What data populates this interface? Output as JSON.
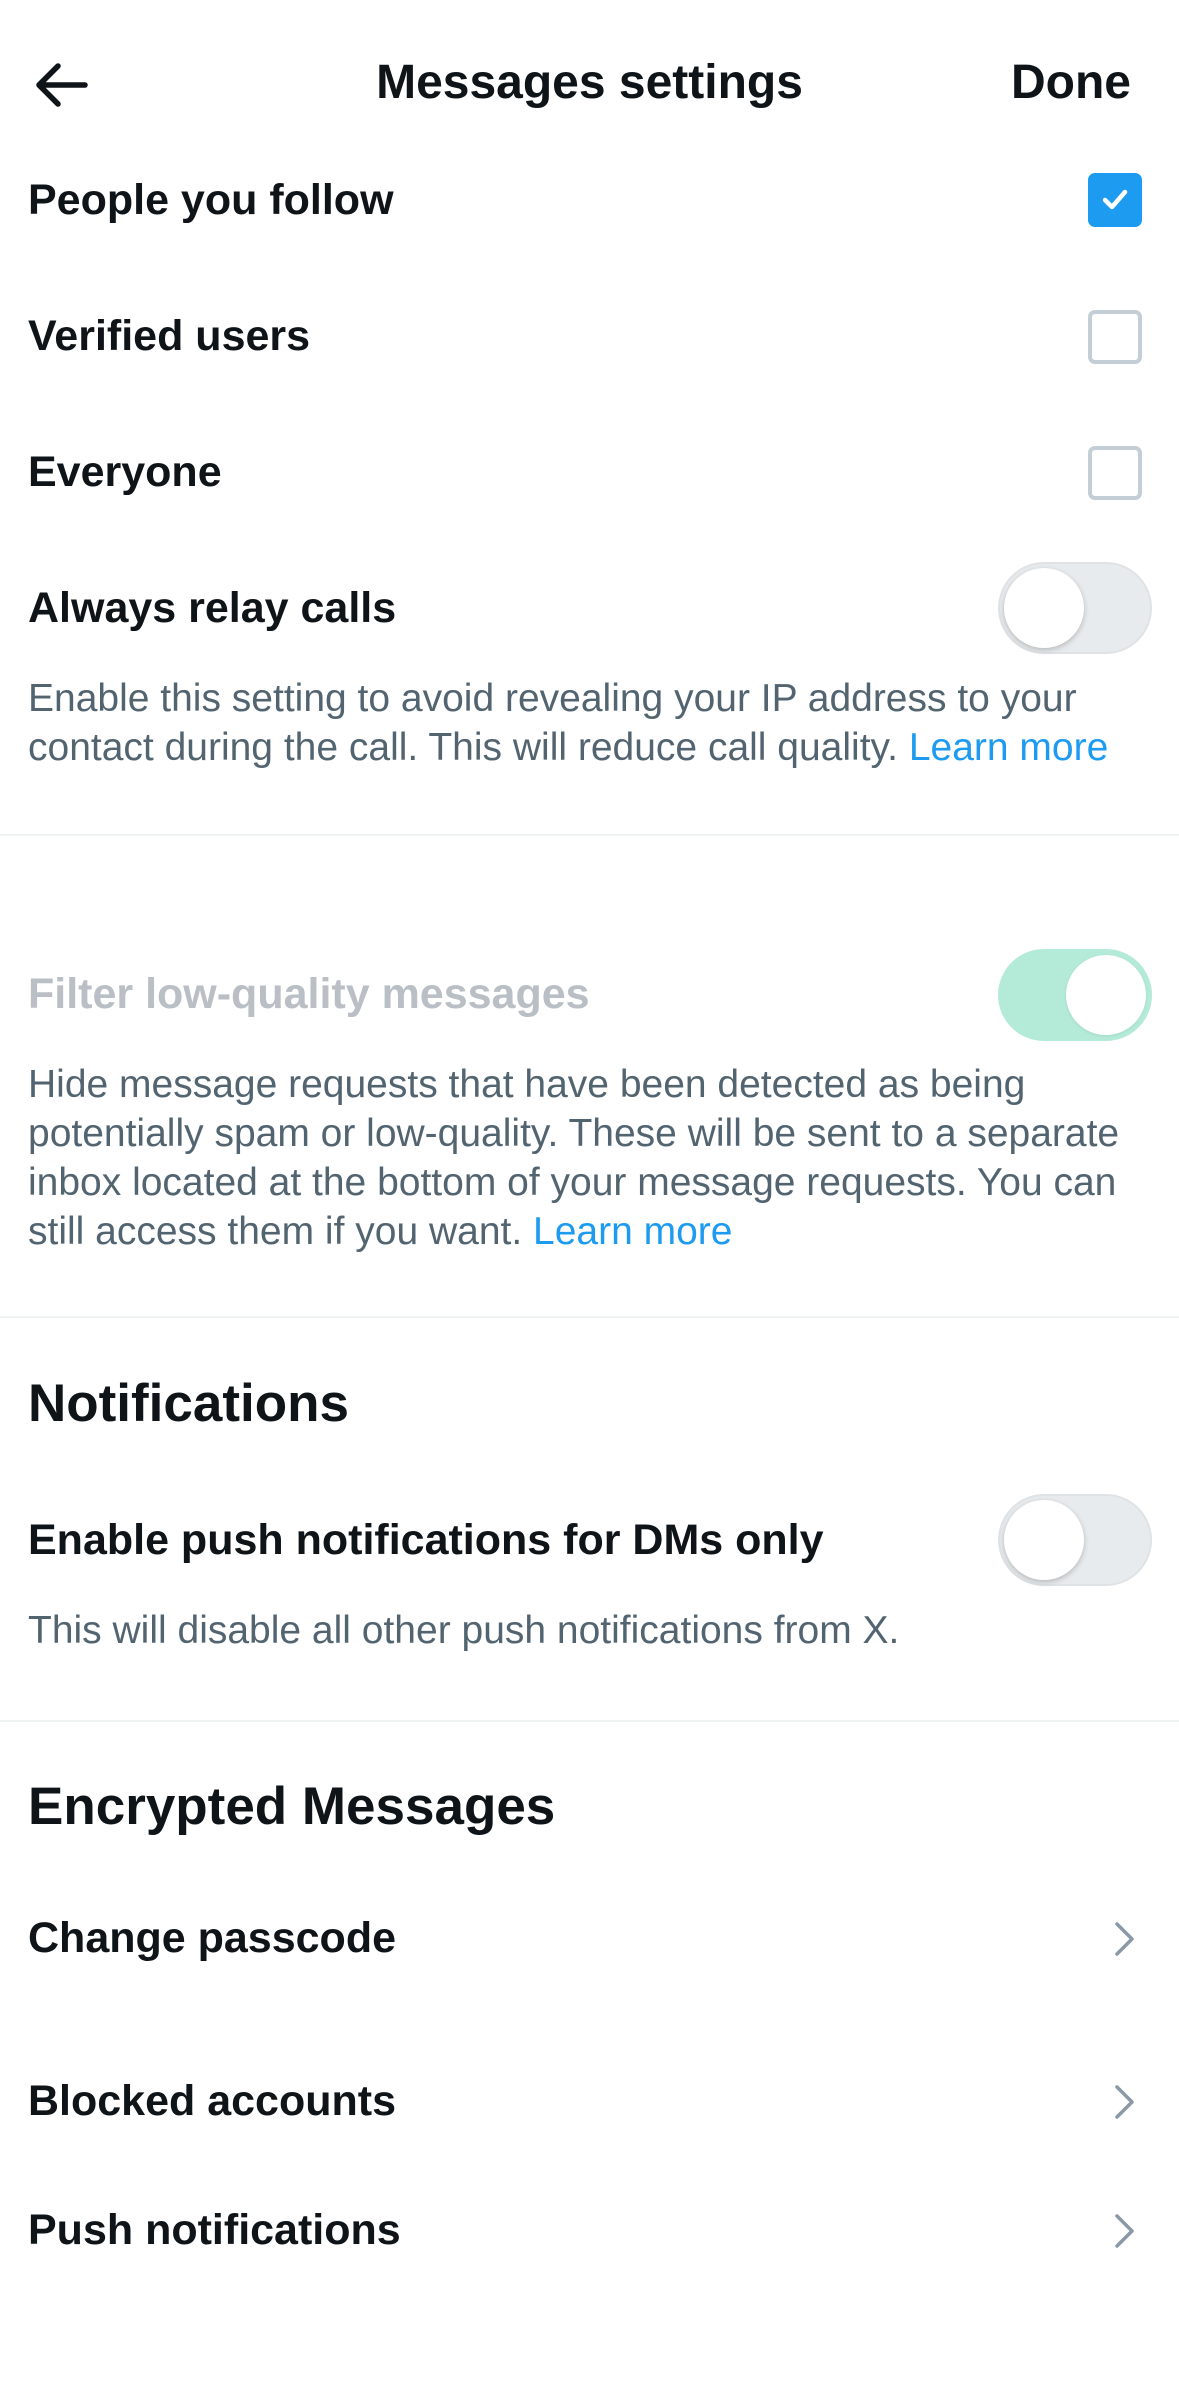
{
  "header": {
    "title": "Messages settings",
    "done_label": "Done"
  },
  "allow_requests": [
    {
      "label": "People you follow",
      "checked": true
    },
    {
      "label": "Verified users",
      "checked": false
    },
    {
      "label": "Everyone",
      "checked": false
    }
  ],
  "relay_calls": {
    "label": "Always relay calls",
    "enabled": false,
    "description": "Enable this setting to avoid revealing your IP address to your contact during the call. This will reduce call quality.",
    "link": "Learn more"
  },
  "filter": {
    "label": "Filter low-quality messages",
    "enabled": true,
    "disabled": true,
    "description": "Hide message requests that have been detected as being potentially spam or low-quality. These will be sent to a separate inbox located at the bottom of your message requests. You can still access them if you want.",
    "link": "Learn more"
  },
  "notifications": {
    "heading": "Notifications",
    "push_label": "Enable push notifications for DMs only",
    "enabled": false,
    "description": "This will disable all other push notifications from X."
  },
  "encrypted": {
    "heading": "Encrypted Messages",
    "items": [
      {
        "label": "Change passcode"
      },
      {
        "label": "Blocked accounts"
      },
      {
        "label": "Push notifications"
      }
    ]
  },
  "colors": {
    "accent": "#1d9bf0",
    "toggle_on": "#b4ead8",
    "text_primary": "#0f1419",
    "text_secondary": "#536471"
  }
}
